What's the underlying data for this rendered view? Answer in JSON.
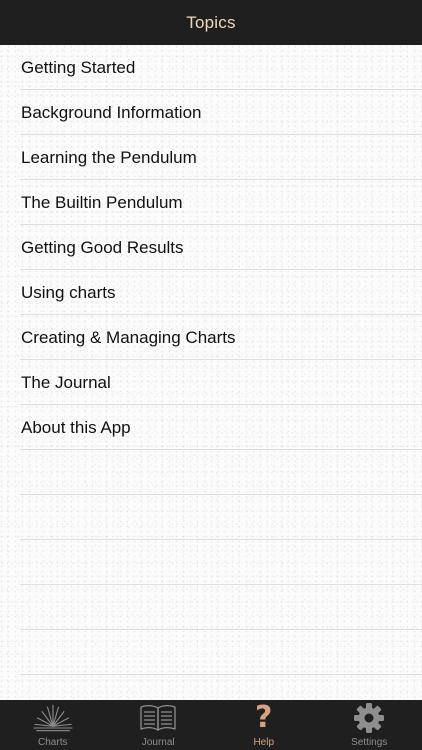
{
  "nav": {
    "title": "Topics"
  },
  "topics": [
    {
      "label": "Getting Started"
    },
    {
      "label": "Background Information"
    },
    {
      "label": "Learning the Pendulum"
    },
    {
      "label": "The Builtin Pendulum"
    },
    {
      "label": "Getting Good Results"
    },
    {
      "label": "Using charts"
    },
    {
      "label": "Creating & Managing Charts"
    },
    {
      "label": "The Journal"
    },
    {
      "label": "About this App"
    }
  ],
  "tabs": [
    {
      "label": "Charts",
      "icon": "charts-fan-icon",
      "active": false
    },
    {
      "label": "Journal",
      "icon": "open-book-icon",
      "active": false
    },
    {
      "label": "Help",
      "icon": "question-mark-icon",
      "active": true
    },
    {
      "label": "Settings",
      "icon": "gear-icon",
      "active": false
    }
  ],
  "colors": {
    "bar_background": "#1f1f1f",
    "accent": "#d8a17f",
    "title": "#f2d8b8",
    "inactive_tab": "#8e8e8e"
  }
}
